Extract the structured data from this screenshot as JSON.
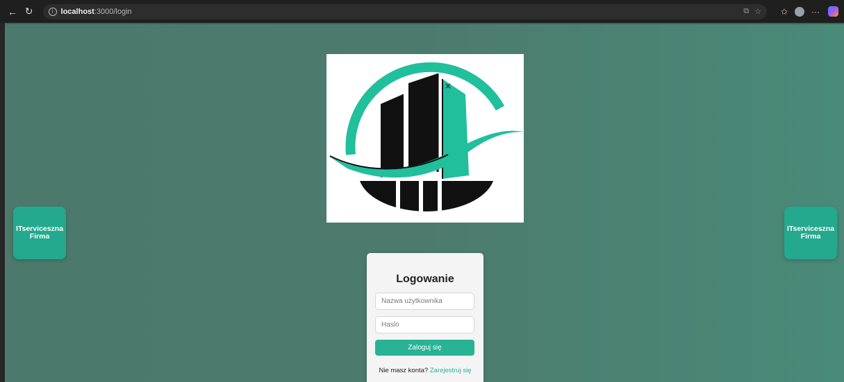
{
  "browser": {
    "url_host": "localhost",
    "url_path": ":3000/login",
    "back_icon": "arrow-left-icon",
    "reload_icon": "reload-icon",
    "info_icon": "info-icon"
  },
  "side_cards": {
    "left": {
      "line1": "ITserviceszna",
      "line2": "Firma"
    },
    "right": {
      "line1": "ITserviceszna",
      "line2": "Firma"
    }
  },
  "login": {
    "title": "Logowanie",
    "username_placeholder": "Nazwa użytkownika",
    "password_placeholder": "Haslo",
    "submit_label": "Zaloguj się",
    "no_account_text": "Nie masz konta?",
    "register_link": "Zarejestruj się"
  },
  "colors": {
    "accent": "#27b394",
    "background": "#4c7b6d",
    "card": "#f4f4f4"
  }
}
